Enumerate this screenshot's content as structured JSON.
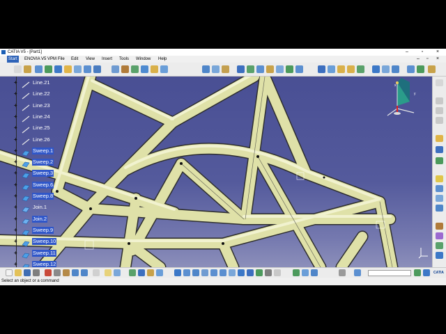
{
  "window": {
    "title": "CATIA V5 - [Part1]",
    "minimize_glyph": "–",
    "maximize_glyph": "▫",
    "close_glyph": "×"
  },
  "menu": {
    "items": [
      "Start",
      "ENOVIA V5 VPM",
      "File",
      "Edit",
      "View",
      "Insert",
      "Tools",
      "Window",
      "Help"
    ],
    "doc_controls": [
      "–",
      "▫",
      "×"
    ]
  },
  "tree": {
    "items": [
      {
        "label": "Line.21",
        "icon": "line-icon",
        "selected": false
      },
      {
        "label": "Line.22",
        "icon": "line-icon",
        "selected": false
      },
      {
        "label": "Line.23",
        "icon": "line-icon",
        "selected": false
      },
      {
        "label": "Line.24",
        "icon": "line-icon",
        "selected": false
      },
      {
        "label": "Line.25",
        "icon": "line-icon",
        "selected": false
      },
      {
        "label": "Line.26",
        "icon": "line-icon",
        "selected": false
      },
      {
        "label": "Sweep.1",
        "icon": "sweep-icon",
        "selected": true
      },
      {
        "label": "Sweep.2",
        "icon": "sweep-icon",
        "selected": true
      },
      {
        "label": "Sweep.3",
        "icon": "sweep-icon",
        "selected": true
      },
      {
        "label": "Sweep.6",
        "icon": "sweep-icon",
        "selected": true
      },
      {
        "label": "Sweep.8",
        "icon": "sweep-icon",
        "selected": true
      },
      {
        "label": "Join.1",
        "icon": "join-icon",
        "selected": false
      },
      {
        "label": "Join.2",
        "icon": "join-icon",
        "selected": true
      },
      {
        "label": "Sweep.9",
        "icon": "sweep-icon",
        "selected": true
      },
      {
        "label": "Sweep.10",
        "icon": "sweep-icon",
        "selected": true
      },
      {
        "label": "Sweep.11",
        "icon": "sweep-icon",
        "selected": true
      },
      {
        "label": "Sweep.12",
        "icon": "sweep-icon",
        "selected": true
      }
    ]
  },
  "compass": {
    "x_label": "x",
    "y_label": "y"
  },
  "status": {
    "message": "Select an object or a command"
  },
  "bottom": {
    "brand": "CATIA"
  },
  "colors": {
    "viewport_top": "#494f94",
    "viewport_bottom": "#8c8fba",
    "tube": "#e4e6b0",
    "tube_shade": "#b9bc83",
    "selection": "#3057c9"
  }
}
